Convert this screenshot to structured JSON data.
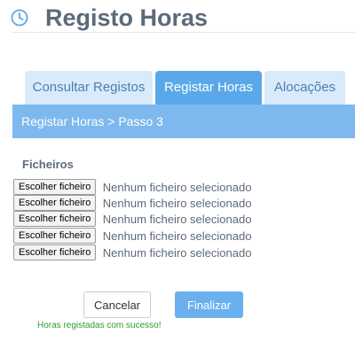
{
  "header": {
    "title": "Registo Horas",
    "icon": "clock-icon"
  },
  "tabs": [
    {
      "label": "Consultar Registos",
      "active": false
    },
    {
      "label": "Registar Horas",
      "active": true
    },
    {
      "label": "Alocações",
      "active": false
    }
  ],
  "stepbar": {
    "text": "Registar Horas > Passo 3"
  },
  "files": {
    "label": "Ficheiros",
    "inputs": [
      {
        "button": "Escolher ficheiro",
        "status": "Nenhum ficheiro selecionado"
      },
      {
        "button": "Escolher ficheiro",
        "status": "Nenhum ficheiro selecionado"
      },
      {
        "button": "Escolher ficheiro",
        "status": "Nenhum ficheiro selecionado"
      },
      {
        "button": "Escolher ficheiro",
        "status": "Nenhum ficheiro selecionado"
      },
      {
        "button": "Escolher ficheiro",
        "status": "Nenhum ficheiro selecionado"
      }
    ]
  },
  "actions": {
    "cancel": "Cancelar",
    "finish": "Finalizar"
  },
  "message": {
    "success": "Horas registadas com sucesso!"
  },
  "colors": {
    "accent": "#5aa8ea",
    "title": "#5d6a79",
    "success": "#2e9c2e"
  }
}
